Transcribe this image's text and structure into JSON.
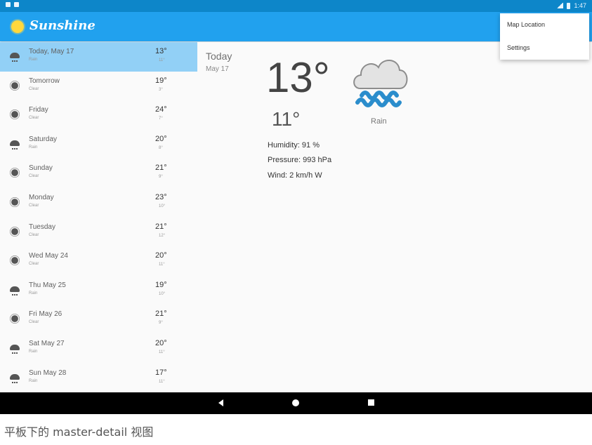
{
  "status_bar": {
    "time": "1:47"
  },
  "app": {
    "title": "Sunshine"
  },
  "overflow_menu": {
    "items": [
      "Map Location",
      "Settings"
    ]
  },
  "forecast_list": [
    {
      "day": "Today, May 17",
      "desc": "Rain",
      "high": "13°",
      "low": "11°",
      "icon": "rain-icon",
      "selected": true
    },
    {
      "day": "Tomorrow",
      "desc": "Clear",
      "high": "19°",
      "low": "3°",
      "icon": "sun-icon"
    },
    {
      "day": "Friday",
      "desc": "Clear",
      "high": "24°",
      "low": "7°",
      "icon": "sun-icon"
    },
    {
      "day": "Saturday",
      "desc": "Rain",
      "high": "20°",
      "low": "8°",
      "icon": "rain-icon"
    },
    {
      "day": "Sunday",
      "desc": "Clear",
      "high": "21°",
      "low": "9°",
      "icon": "sun-icon"
    },
    {
      "day": "Monday",
      "desc": "Clear",
      "high": "23°",
      "low": "10°",
      "icon": "sun-icon"
    },
    {
      "day": "Tuesday",
      "desc": "Clear",
      "high": "21°",
      "low": "12°",
      "icon": "sun-icon"
    },
    {
      "day": "Wed May 24",
      "desc": "Clear",
      "high": "20°",
      "low": "11°",
      "icon": "sun-icon"
    },
    {
      "day": "Thu May 25",
      "desc": "Rain",
      "high": "19°",
      "low": "10°",
      "icon": "rain-icon"
    },
    {
      "day": "Fri May 26",
      "desc": "Clear",
      "high": "21°",
      "low": "9°",
      "icon": "sun-icon"
    },
    {
      "day": "Sat May 27",
      "desc": "Rain",
      "high": "20°",
      "low": "11°",
      "icon": "rain-icon"
    },
    {
      "day": "Sun May 28",
      "desc": "Rain",
      "high": "17°",
      "low": "11°",
      "icon": "rain-icon"
    }
  ],
  "detail": {
    "day": "Today",
    "date": "May 17",
    "high": "13°",
    "low": "11°",
    "humidity": "Humidity: 91 %",
    "pressure": "Pressure: 993 hPa",
    "wind": "Wind: 2 km/h W",
    "condition": "Rain",
    "icon": "rain-cloud-icon"
  },
  "caption": "平板下的 master-detail 视图",
  "colors": {
    "status_bar": "#0d86c9",
    "app_bar": "#21a1ee",
    "selected_row": "#92d0f6",
    "nav_bar": "#000000"
  }
}
